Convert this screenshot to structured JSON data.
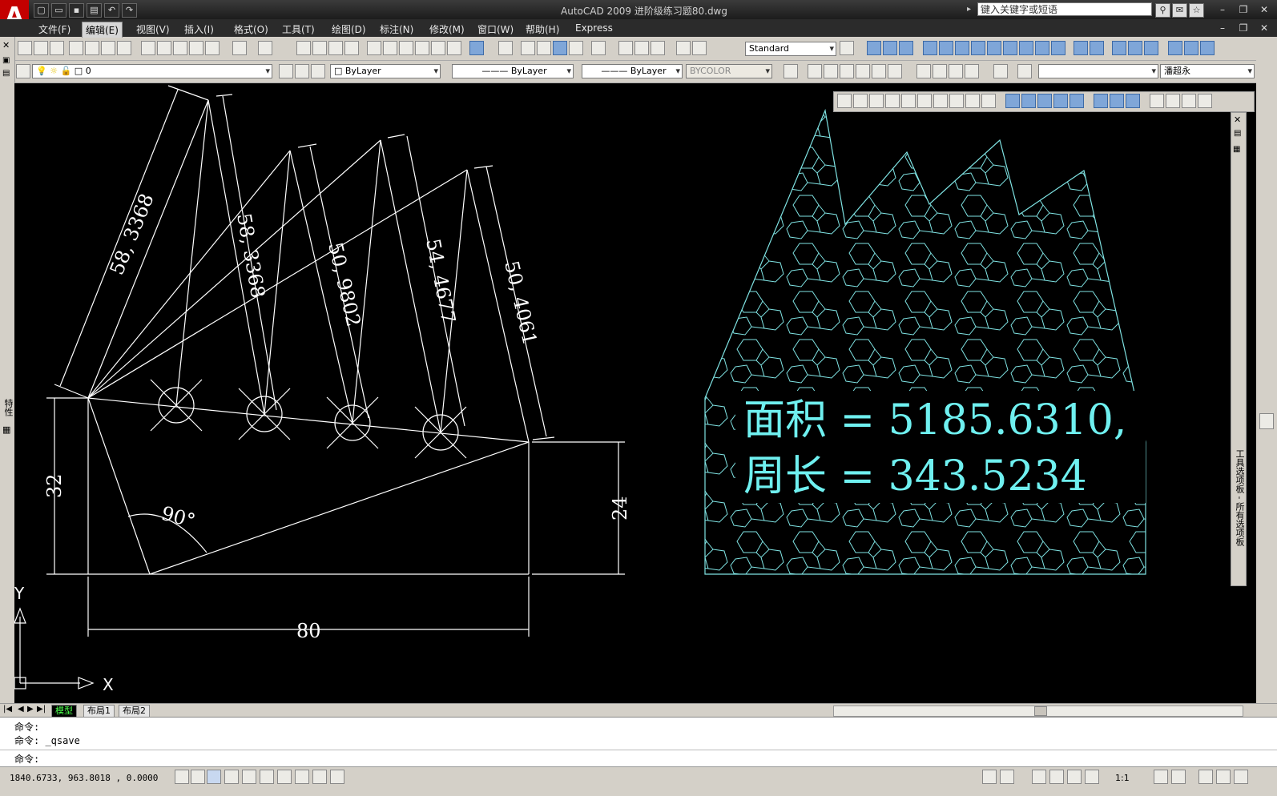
{
  "window": {
    "title": "AutoCAD 2009  进阶级练习题80.dwg",
    "search_placeholder": "键入关键字或短语",
    "logo": "A",
    "win_min": "–",
    "win_restore": "❐",
    "win_close": "✕"
  },
  "menu": [
    "文件(F)",
    "编辑(E)",
    "视图(V)",
    "插入(I)",
    "格式(O)",
    "工具(T)",
    "绘图(D)",
    "标注(N)",
    "修改(M)",
    "窗口(W)",
    "帮助(H)",
    "Express"
  ],
  "toolbar": {
    "text_style": "Standard",
    "layer": "0",
    "color": "ByLayer",
    "linetype": "ByLayer",
    "lineweight": "ByLayer",
    "plotstyle": "BYCOLOR",
    "workspace": "潘超永"
  },
  "drawing": {
    "dim_top_left": "58, 3368",
    "dim_top_2": "58, 3368",
    "dim_top_3": "50, 9802",
    "dim_top_4": "54, 4677",
    "dim_top_5": "50, 4061",
    "dim_left": "32",
    "dim_right": "24",
    "dim_bottom": "80",
    "dim_angle": "90°",
    "area_text": "面积 = 5185.6310,",
    "perimeter_text": "周长 = 343.5234",
    "ucs_y": "Y",
    "ucs_x": "X"
  },
  "palette": {
    "side_label": "特性",
    "right_label": "工具选项板 - 所有选项板"
  },
  "tabs": [
    "模型",
    "布局1",
    "布局2"
  ],
  "command": {
    "line1": "命令:",
    "line2": "命令: _qsave",
    "prompt": "命令:"
  },
  "status": {
    "coords": "1840.6733, 963.8018 , 0.0000",
    "scale": "1:1"
  },
  "colors": {
    "background": "#000000",
    "geometry": "#ffffff",
    "hatch": "#7fe3e3",
    "text_cyan": "#6ff0f0",
    "menu_bg": "#2b2b2b"
  }
}
